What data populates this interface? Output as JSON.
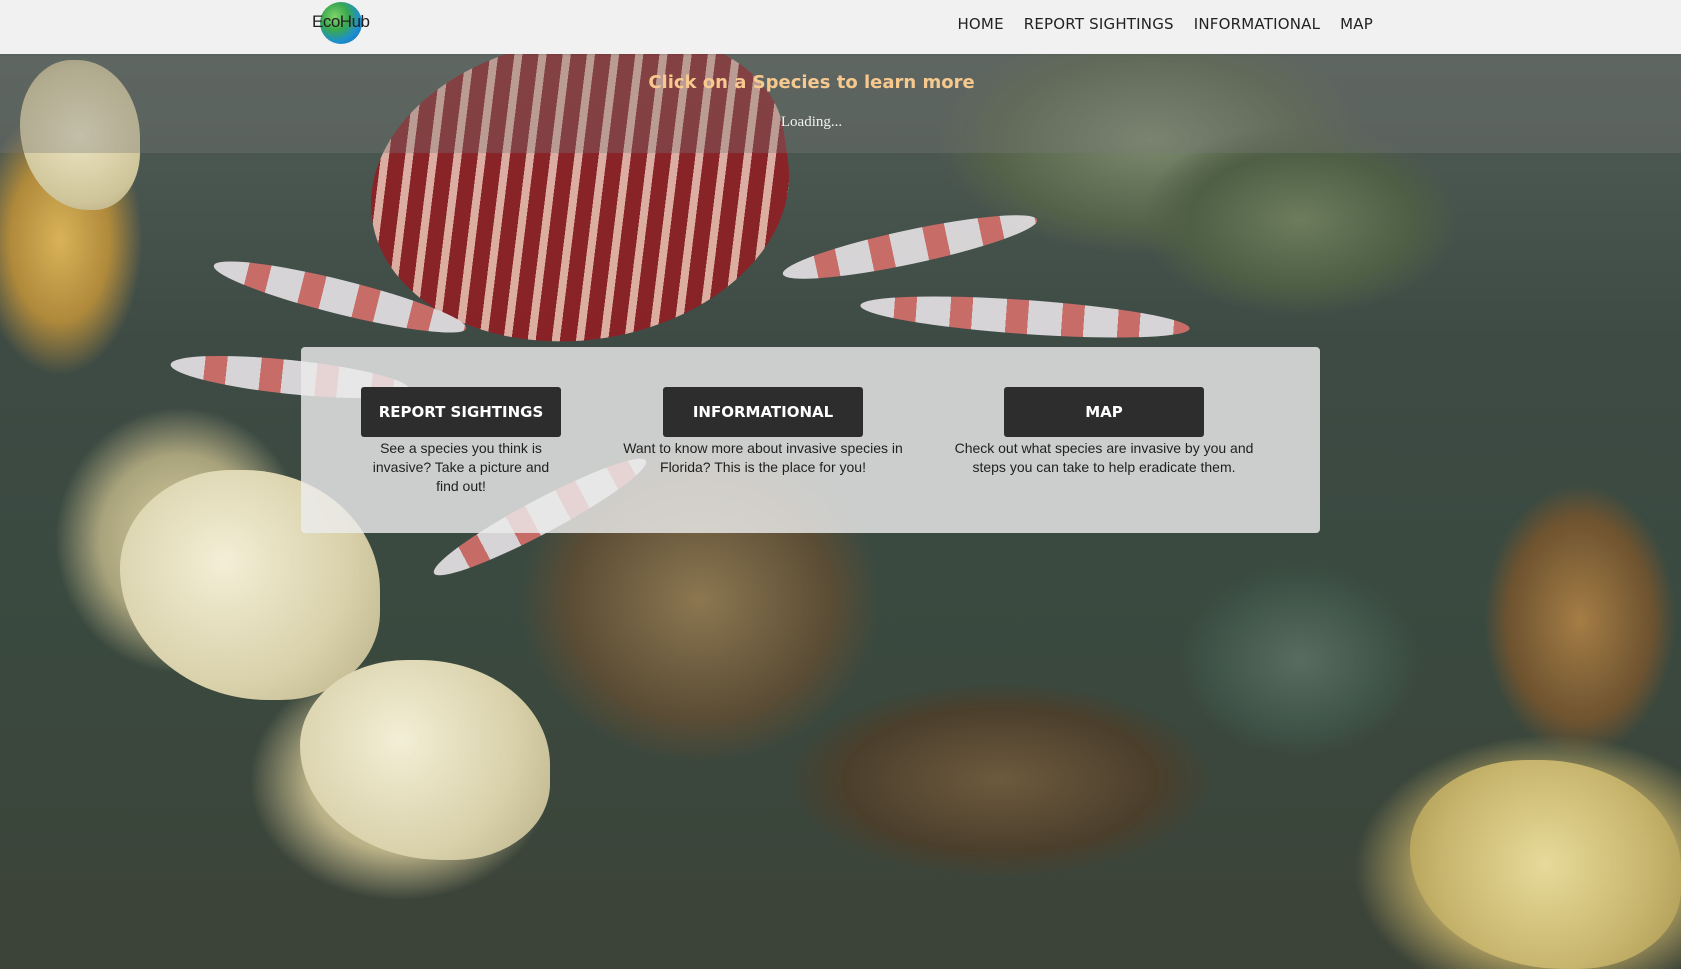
{
  "header": {
    "logo_text": "EcoHub",
    "nav": [
      {
        "label": "HOME"
      },
      {
        "label": "REPORT SIGHTINGS"
      },
      {
        "label": "INFORMATIONAL"
      },
      {
        "label": "MAP"
      }
    ]
  },
  "banner": {
    "title": "Click on a Species to learn more",
    "status": "Loading..."
  },
  "features": [
    {
      "button": "REPORT SIGHTINGS",
      "description": "See a species you think is invasive? Take a picture and find out!"
    },
    {
      "button": "INFORMATIONAL",
      "description": "Want to know more about invasive species in Florida? This is the place for you!"
    },
    {
      "button": "MAP",
      "description": "Check out what species are invasive by you and steps you can take to help eradicate them."
    }
  ],
  "colors": {
    "header_bg": "#f1f1f1",
    "banner_title": "#f7c98f",
    "button_bg": "#2d2d2d"
  }
}
